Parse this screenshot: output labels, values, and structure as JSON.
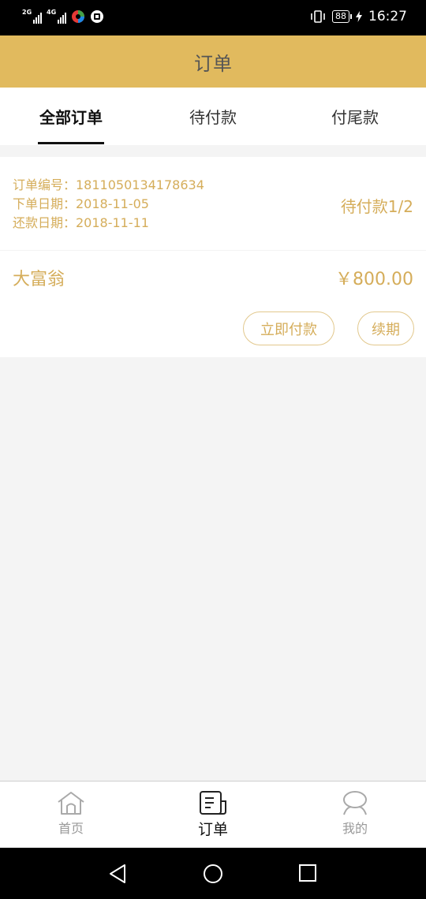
{
  "status_bar": {
    "network_1": "2G",
    "network_2": "4G",
    "battery": "88",
    "time": "16:27"
  },
  "header": {
    "title": "订单"
  },
  "tabs": [
    {
      "label": "全部订单",
      "active": true
    },
    {
      "label": "待付款",
      "active": false
    },
    {
      "label": "付尾款",
      "active": false
    }
  ],
  "order": {
    "number_row": "订单编号：1811050134178634",
    "order_date_row": "下单日期：2018-11-05",
    "repay_date_row": "还款日期：2018-11-11",
    "status": "待付款1/2",
    "product_name": "大富翁",
    "price": "￥800.00",
    "pay_button": "立即付款",
    "renew_button": "续期"
  },
  "bottom_nav": [
    {
      "label": "首页",
      "icon": "home-icon"
    },
    {
      "label": "订单",
      "icon": "document-icon",
      "active": true
    },
    {
      "label": "我的",
      "icon": "user-icon"
    }
  ],
  "colors": {
    "accent": "#e1ba5e",
    "order_text": "#d5ad5a"
  }
}
